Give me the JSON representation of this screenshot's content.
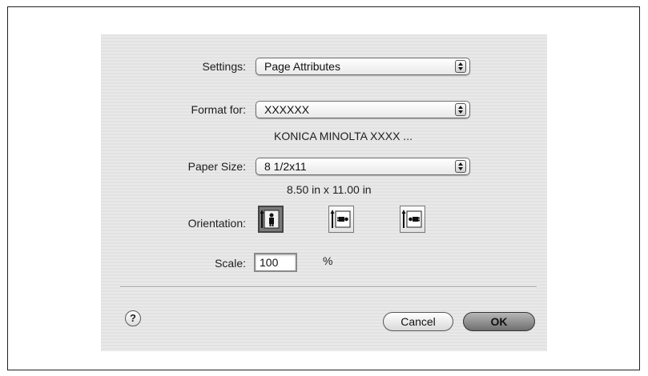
{
  "settings": {
    "label": "Settings:",
    "value": "Page Attributes"
  },
  "format_for": {
    "label": "Format for:",
    "value": "XXXXXX",
    "printer": "KONICA MINOLTA XXXX ..."
  },
  "paper_size": {
    "label": "Paper Size:",
    "value": "8 1/2x11",
    "dimensions": "8.50 in x 11.00 in"
  },
  "orientation": {
    "label": "Orientation:",
    "options": [
      {
        "icon": "portrait-orientation-icon",
        "selected": true
      },
      {
        "icon": "landscape-left-orientation-icon",
        "selected": false
      },
      {
        "icon": "landscape-right-orientation-icon",
        "selected": false
      }
    ]
  },
  "scale": {
    "label": "Scale:",
    "value": "100",
    "unit": "%"
  },
  "buttons": {
    "help": "?",
    "cancel": "Cancel",
    "ok": "OK"
  }
}
